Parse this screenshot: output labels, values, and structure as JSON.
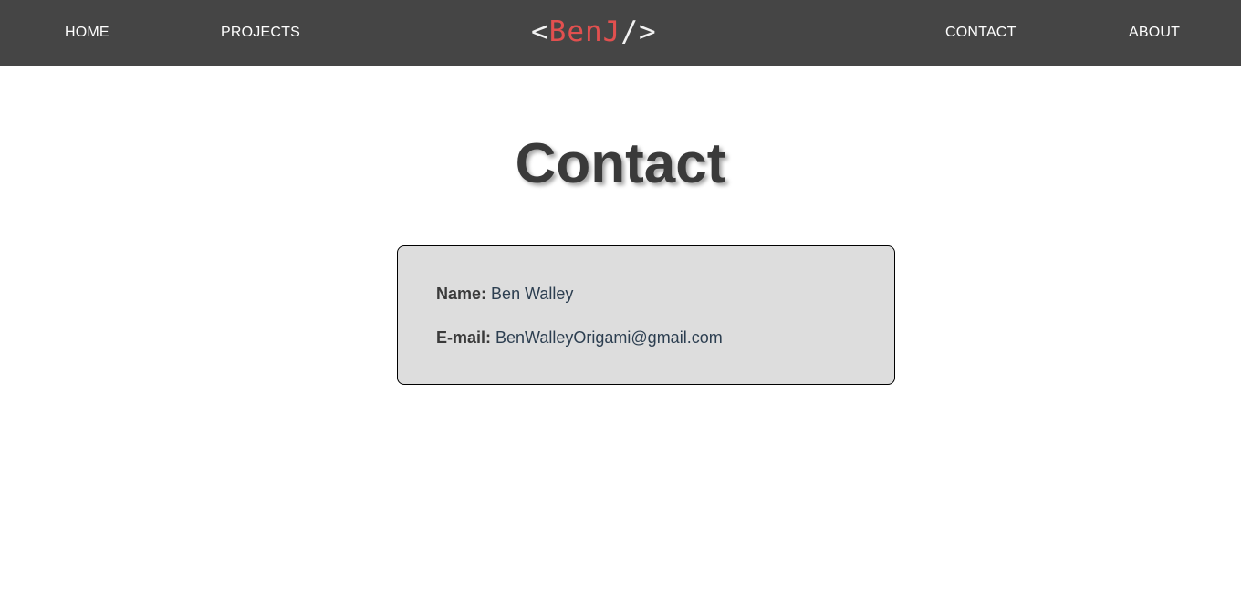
{
  "nav": {
    "home": "HOME",
    "projects": "PROJECTS",
    "contact": "CONTACT",
    "about": "ABOUT"
  },
  "logo": {
    "open": "<",
    "name": "BenJ",
    "close": "/>"
  },
  "page": {
    "title": "Contact"
  },
  "contact": {
    "name_label": "Name:",
    "name_value": "Ben Walley",
    "email_label": "E-mail:",
    "email_value": "BenWalleyOrigami@gmail.com"
  },
  "colors": {
    "navbar_bg": "#454545",
    "logo_accent": "#e2504f",
    "card_bg": "#dddddd",
    "value_text": "#2c3e50"
  }
}
